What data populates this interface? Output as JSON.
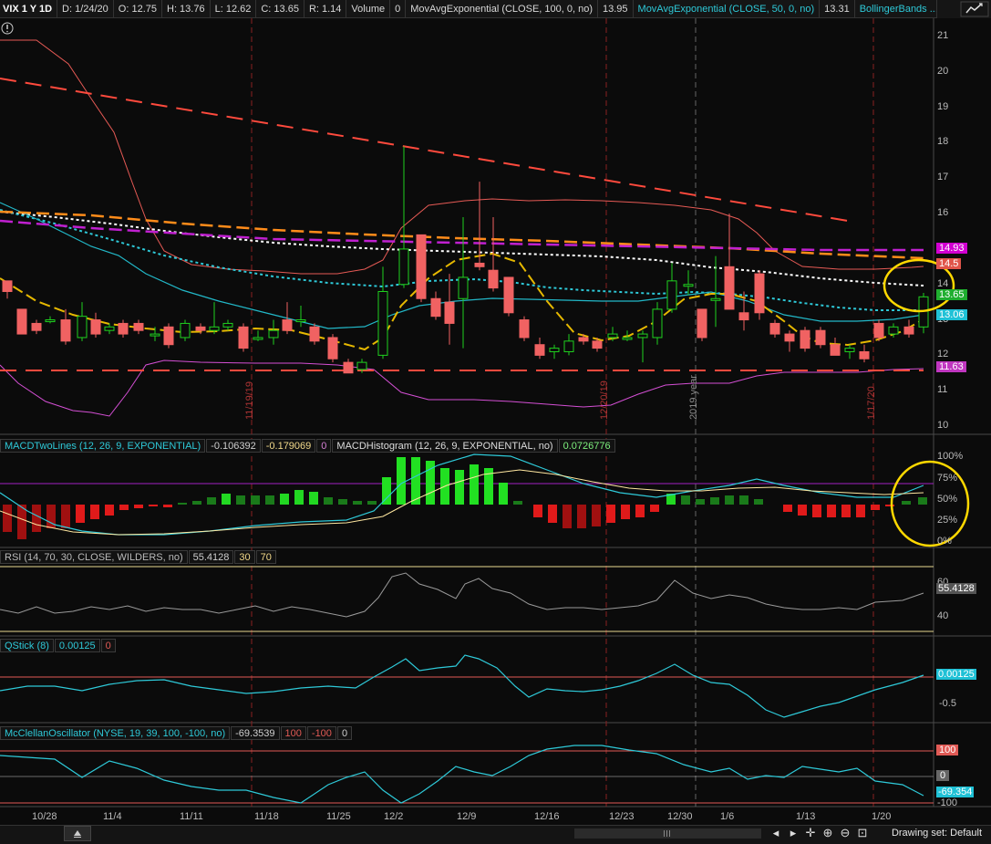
{
  "header": {
    "symbol": "VIX 1 Y 1D",
    "date": "D: 1/24/20",
    "open": "O: 12.75",
    "high": "H: 13.76",
    "low": "L: 12.62",
    "close": "C: 13.65",
    "range": "R: 1.14",
    "volume_label": "Volume",
    "volume_value": "0",
    "ema100_label": "MovAvgExponential (CLOSE, 100, 0, no)",
    "ema100_value": "13.95",
    "ema50_label": "MovAvgExponential (CLOSE, 50, 0, no)",
    "ema50_value": "13.31",
    "bb_label": "BollingerBands ..."
  },
  "price_axis": {
    "ticks": [
      "21",
      "20",
      "19",
      "18",
      "17",
      "16",
      "15",
      "14",
      "13",
      "12",
      "11",
      "10"
    ],
    "badges": [
      {
        "text": "14.93",
        "color": "#d100d1"
      },
      {
        "text": "14.5",
        "color": "#e0554a"
      },
      {
        "text": "13.65",
        "color": "#1fae2f"
      },
      {
        "text": "13.06",
        "color": "#1fc1d6"
      },
      {
        "text": "11.63",
        "color": "#c036c0"
      }
    ]
  },
  "vertical_labels": [
    "11/19/19",
    "12/20/19",
    "2019 year",
    "1/17/20"
  ],
  "macd": {
    "lines_label": "MACDTwoLines (12, 26, 9, EXPONENTIAL)",
    "value1": "-0.106392",
    "value2": "-0.179069",
    "value3": "0",
    "hist_label": "MACDHistogram (12, 26, 9, EXPONENTIAL, no)",
    "hist_value": "0.0726776",
    "ticks": [
      "100%",
      "75%",
      "50%",
      "25%",
      "0%"
    ]
  },
  "rsi": {
    "label": "RSI (14, 70, 30, CLOSE, WILDERS, no)",
    "value": "55.4128",
    "ob": "30",
    "os": "70",
    "ticks": [
      "60",
      "40"
    ],
    "badge": "55.4128"
  },
  "qstick": {
    "label": "QStick (8)",
    "value": "0.00125",
    "zero": "0",
    "ticks": [
      "-0.5"
    ],
    "badge": "0.00125"
  },
  "mcclellan": {
    "label": "McClellanOscillator (NYSE, 19, 39, 100, -100, no)",
    "value": "-69.3539",
    "up": "100",
    "down": "-100",
    "zero": "0",
    "ticks": [
      "100",
      "0",
      "-100"
    ],
    "badge": "-69.354"
  },
  "x_axis": [
    "10/28",
    "11/4",
    "11/11",
    "11/18",
    "11/25",
    "12/2",
    "12/9",
    "12/16",
    "12/23",
    "12/30",
    "1/6",
    "1/13",
    "1/20"
  ],
  "footer": {
    "drawing_set": "Drawing set: Default"
  },
  "colors": {
    "up": "#1fd11f",
    "down": "#f06262",
    "ema50": "#2ec9d8",
    "ema100": "#ffffff",
    "trend": "#ff4a3d",
    "ma_orange": "#ff8c1a",
    "ma_magenta": "#d100d1",
    "bb": "#ff6a6a",
    "highlight": "#ffd800"
  }
}
